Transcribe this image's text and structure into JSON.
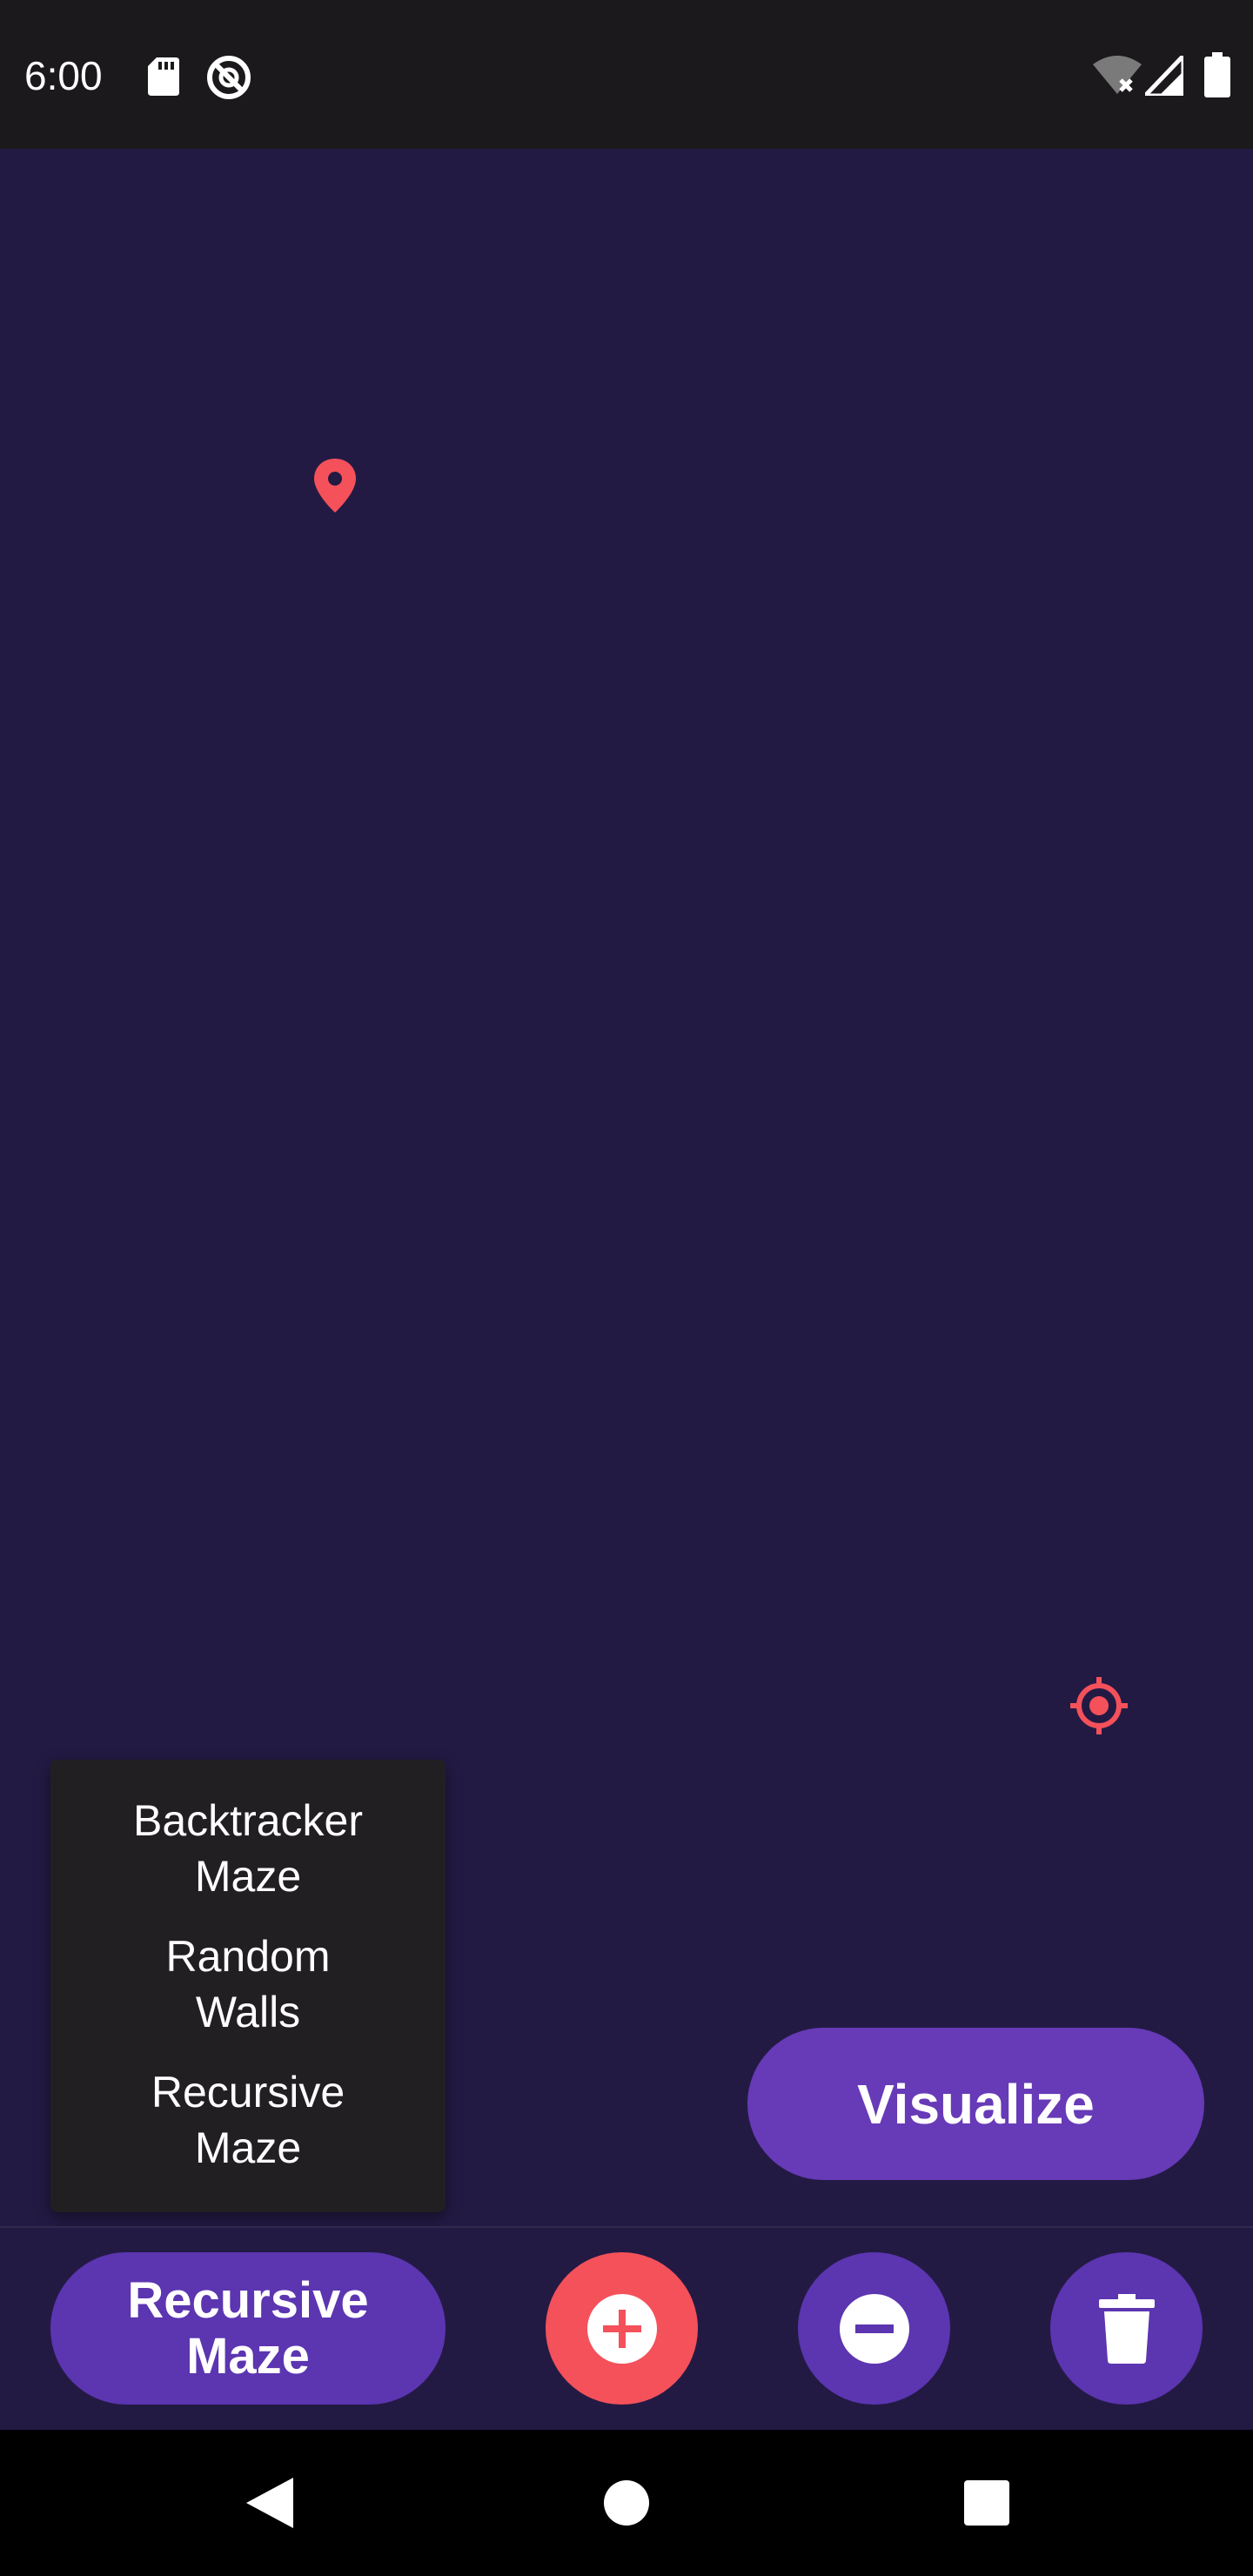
{
  "status_bar": {
    "time": "6:00",
    "icons": [
      "sd-card-icon",
      "do-not-disturb-icon",
      "wifi-off-icon",
      "cell-signal-icon",
      "battery-icon"
    ]
  },
  "grid": {
    "background": "#231a44",
    "start_marker": {
      "icon": "location-pin-icon",
      "color": "#f4515a"
    },
    "target_marker": {
      "icon": "crosshair-target-icon",
      "color": "#f4515a"
    }
  },
  "maze_menu": {
    "items": [
      {
        "label": "Backtracker\nMaze"
      },
      {
        "label": "Random\nWalls"
      },
      {
        "label": "Recursive\nMaze"
      }
    ]
  },
  "visualize_button": {
    "label": "Visualize",
    "color": "#673ab7"
  },
  "bottom_bar": {
    "algorithm_button": {
      "label": "Recursive\nMaze",
      "color": "#5c35b1"
    },
    "add_button": {
      "icon": "add-circle-icon",
      "color": "#f4515a"
    },
    "remove_button": {
      "icon": "remove-circle-icon",
      "color": "#5c35b1"
    },
    "delete_button": {
      "icon": "trash-icon",
      "color": "#5c35b1"
    }
  },
  "nav_bar": {
    "icons": [
      "back-triangle-icon",
      "home-circle-icon",
      "recents-square-icon"
    ]
  }
}
